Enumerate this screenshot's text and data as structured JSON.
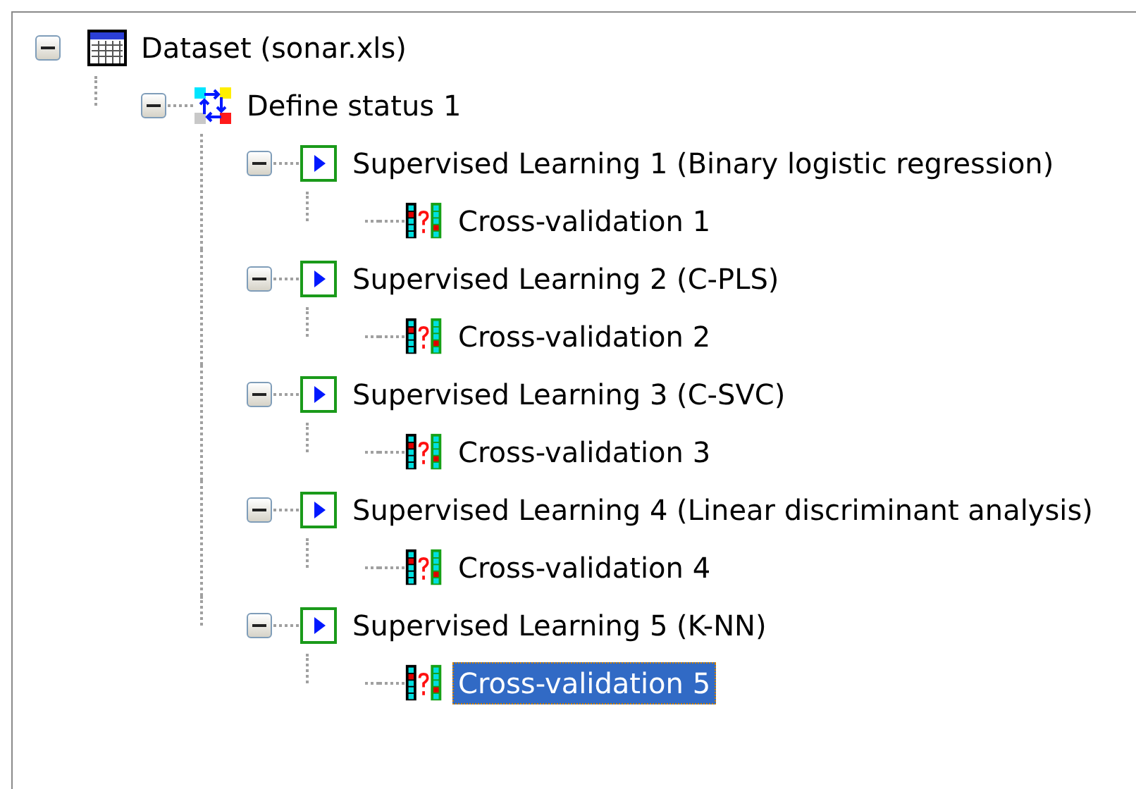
{
  "tree": [
    {
      "label": "Dataset (sonar.xls)",
      "kind": "dataset",
      "expanded": true,
      "selected": false,
      "children": [
        {
          "label": "Define status 1",
          "kind": "status",
          "expanded": true,
          "selected": false,
          "children": [
            {
              "label": "Supervised Learning 1 (Binary logistic regression)",
              "kind": "learning",
              "expanded": true,
              "selected": false,
              "children": [
                {
                  "label": "Cross-validation 1",
                  "kind": "validation",
                  "selected": false
                }
              ]
            },
            {
              "label": "Supervised Learning 2 (C-PLS)",
              "kind": "learning",
              "expanded": true,
              "selected": false,
              "children": [
                {
                  "label": "Cross-validation 2",
                  "kind": "validation",
                  "selected": false
                }
              ]
            },
            {
              "label": "Supervised Learning 3 (C-SVC)",
              "kind": "learning",
              "expanded": true,
              "selected": false,
              "children": [
                {
                  "label": "Cross-validation 3",
                  "kind": "validation",
                  "selected": false
                }
              ]
            },
            {
              "label": "Supervised Learning 4 (Linear discriminant analysis)",
              "kind": "learning",
              "expanded": true,
              "selected": false,
              "children": [
                {
                  "label": "Cross-validation 4",
                  "kind": "validation",
                  "selected": false
                }
              ]
            },
            {
              "label": "Supervised Learning 5 (K-NN)",
              "kind": "learning",
              "expanded": true,
              "selected": false,
              "children": [
                {
                  "label": "Cross-validation 5",
                  "kind": "validation",
                  "selected": true
                }
              ]
            }
          ]
        }
      ]
    }
  ]
}
